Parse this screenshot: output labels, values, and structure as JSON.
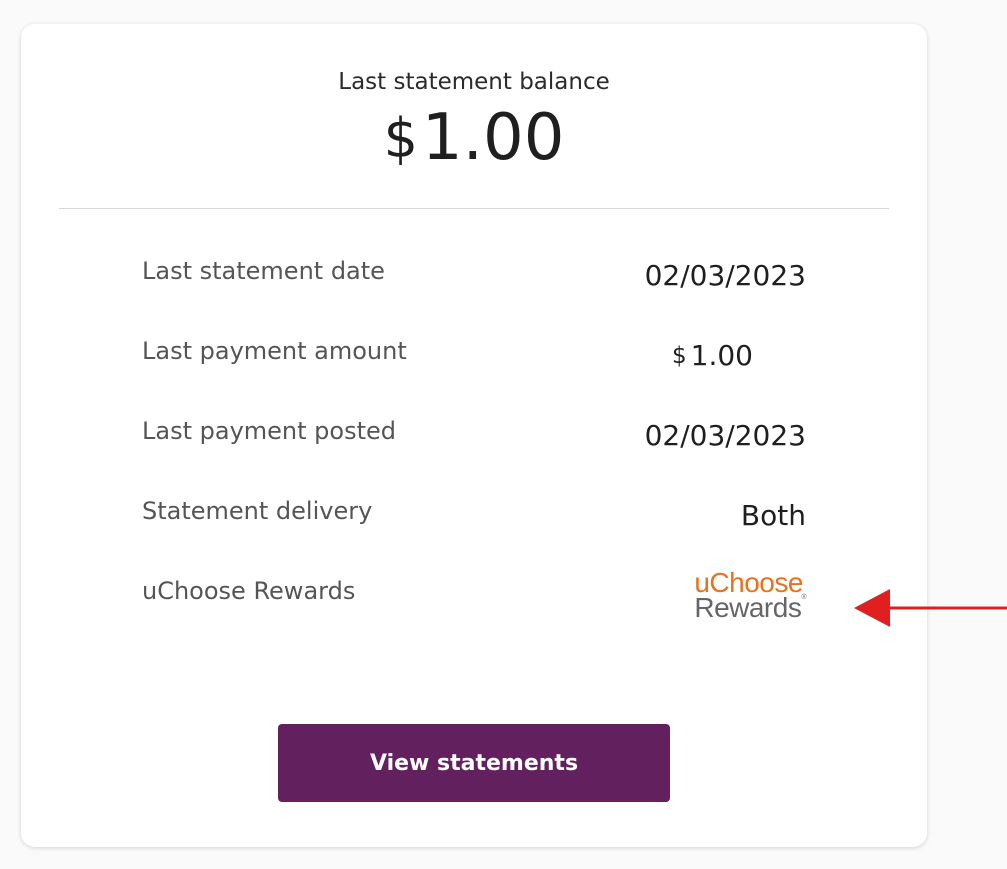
{
  "balance": {
    "label": "Last statement balance",
    "currency": "$",
    "amount": "1.00"
  },
  "details": {
    "statement_date": {
      "label": "Last statement date",
      "value": "02/03/2023"
    },
    "payment_amount": {
      "label": "Last payment amount",
      "currency": "$",
      "value": "1.00"
    },
    "payment_posted": {
      "label": "Last payment posted",
      "value": "02/03/2023"
    },
    "delivery": {
      "label": "Statement delivery",
      "value": "Both"
    },
    "rewards": {
      "label": "uChoose Rewards",
      "logo_top": "uChoose",
      "logo_bottom": "Rewards"
    }
  },
  "actions": {
    "view_statements_label": "View statements"
  },
  "colors": {
    "button": "#63205e",
    "logo_orange": "#e8721f",
    "logo_gray": "#666666",
    "annotation_arrow": "#e02020"
  },
  "annotation": {
    "icon": "left-arrow-icon"
  }
}
